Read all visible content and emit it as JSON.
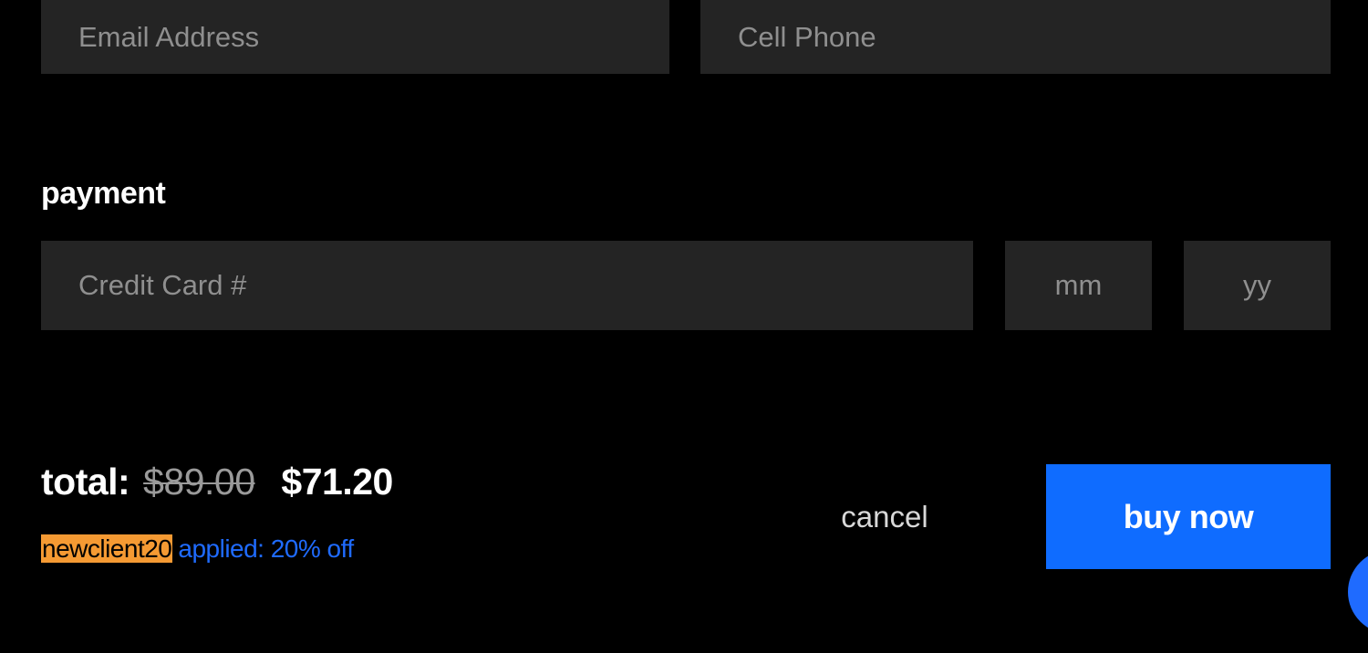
{
  "contact": {
    "email_placeholder": "Email Address",
    "phone_placeholder": "Cell Phone"
  },
  "payment": {
    "heading": "payment",
    "card_placeholder": "Credit Card #",
    "month_placeholder": "mm",
    "year_placeholder": "yy"
  },
  "total": {
    "label": "total:",
    "original_price": "$89.00",
    "discounted_price": "$71.20"
  },
  "promo": {
    "code": "newclient20",
    "applied_text": "applied: 20% off"
  },
  "actions": {
    "cancel_label": "cancel",
    "buy_label": "buy now"
  },
  "colors": {
    "background": "#000000",
    "field_background": "#242424",
    "accent_blue": "#0f6cff",
    "promo_highlight": "#f59a33"
  }
}
